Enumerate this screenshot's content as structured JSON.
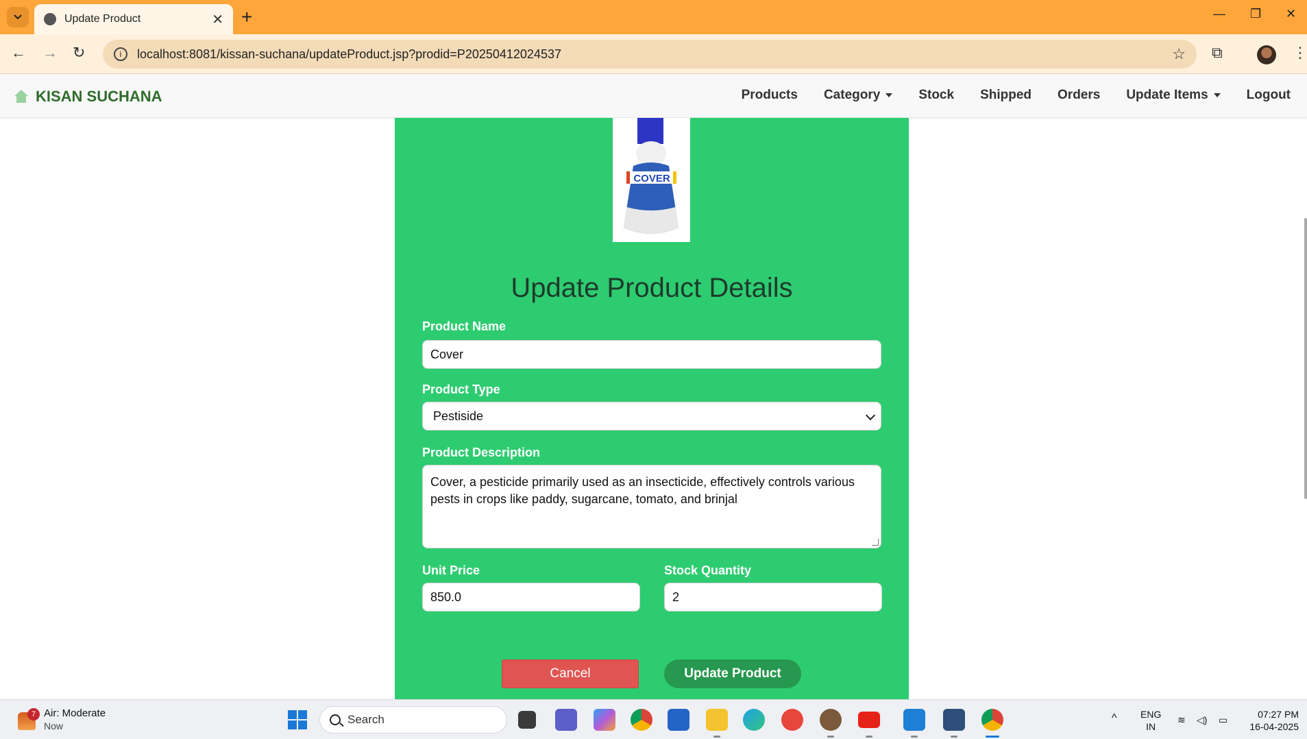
{
  "browser": {
    "tab_title": "Update Product",
    "url": "localhost:8081/kissan-suchana/updateProduct.jsp?prodid=P20250412024537"
  },
  "navbar": {
    "brand": "KISAN SUCHANA",
    "items": [
      "Products",
      "Category",
      "Stock",
      "Shipped",
      "Orders",
      "Update Items",
      "Logout"
    ]
  },
  "form": {
    "heading": "Update Product Details",
    "product_image_label": "COVER",
    "name_label": "Product Name",
    "name_value": "Cover",
    "type_label": "Product Type",
    "type_value": "Pestiside",
    "desc_label": "Product Description",
    "desc_value": "Cover, a pesticide primarily used as an insecticide, effectively controls various pests in crops like paddy, sugarcane, tomato, and brinjal",
    "price_label": "Unit Price",
    "price_value": "850.0",
    "qty_label": "Stock Quantity",
    "qty_value": "2",
    "cancel_label": "Cancel",
    "update_label": "Update Product"
  },
  "taskbar": {
    "weather_title": "Air: Moderate",
    "weather_sub": "Now",
    "weather_badge": "7",
    "search_placeholder": "Search",
    "lang_top": "ENG",
    "lang_bottom": "IN",
    "time": "07:27 PM",
    "date": "16-04-2025"
  },
  "colors": {
    "panel": "#2ecc71",
    "brand": "#2e6b2a",
    "cancel": "#e05552",
    "update": "#27984f",
    "tabbar": "#ffa63a"
  }
}
